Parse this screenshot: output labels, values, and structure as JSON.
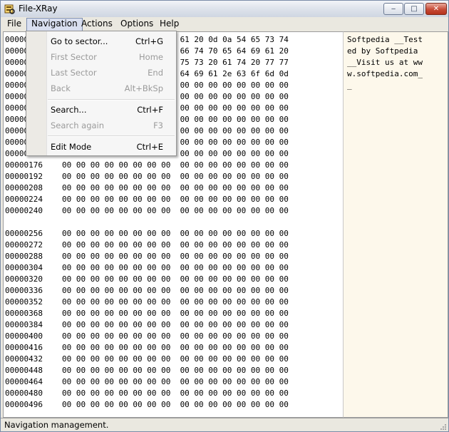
{
  "window": {
    "title": "File-XRay",
    "buttons": {
      "minimize": "‒",
      "maximize": "□",
      "close": "✕"
    }
  },
  "menubar": {
    "items": [
      "File",
      "Navigation",
      "Actions",
      "Options",
      "Help"
    ],
    "active": "Navigation"
  },
  "hex_rows": [
    {
      "addr": "00000000",
      "bytes": "53 6f 66 74 70 65 64 69  61 20 0d 0a 54 65 73 74"
    },
    {
      "addr": "00000016",
      "bytes": "65 64 20 62 79 20 53 6f  66 74 70 65 64 69 61 20"
    },
    {
      "addr": "00000032",
      "bytes": "0d 0a 56 69 73 69 74 20  75 73 20 61 74 20 77 77"
    },
    {
      "addr": "00000048",
      "bytes": "77 2e 73 6f 66 74 70 65  64 69 61 2e 63 6f 6d 0d"
    },
    {
      "addr": "00000064",
      "bytes": "0a 00 00 00 00 00 00 00  00 00 00 00 00 00 00 00"
    },
    {
      "addr": "00000080",
      "bytes": "00 00 00 00 00 00 00 00  00 00 00 00 00 00 00 00"
    },
    {
      "addr": "00000096",
      "bytes": "00 00 00 00 00 00 00 00  00 00 00 00 00 00 00 00"
    },
    {
      "addr": "00000112",
      "bytes": "00 00 00 00 00 00 00 00  00 00 00 00 00 00 00 00"
    },
    {
      "addr": "00000128",
      "bytes": "00 00 00 00 00 00 00 00  00 00 00 00 00 00 00 00"
    },
    {
      "addr": "00000144",
      "bytes": "00 00 00 00 00 00 00 00  00 00 00 00 00 00 00 00"
    },
    {
      "addr": "00000160",
      "bytes": "00 00 00 00 00 00 00 00  00 00 00 00 00 00 00 00"
    },
    {
      "addr": "00000176",
      "bytes": "00 00 00 00 00 00 00 00  00 00 00 00 00 00 00 00"
    },
    {
      "addr": "00000192",
      "bytes": "00 00 00 00 00 00 00 00  00 00 00 00 00 00 00 00"
    },
    {
      "addr": "00000208",
      "bytes": "00 00 00 00 00 00 00 00  00 00 00 00 00 00 00 00"
    },
    {
      "addr": "00000224",
      "bytes": "00 00 00 00 00 00 00 00  00 00 00 00 00 00 00 00"
    },
    {
      "addr": "00000240",
      "bytes": "00 00 00 00 00 00 00 00  00 00 00 00 00 00 00 00"
    },
    {
      "addr": "00000256",
      "bytes": "00 00 00 00 00 00 00 00  00 00 00 00 00 00 00 00"
    },
    {
      "addr": "00000272",
      "bytes": "00 00 00 00 00 00 00 00  00 00 00 00 00 00 00 00"
    },
    {
      "addr": "00000288",
      "bytes": "00 00 00 00 00 00 00 00  00 00 00 00 00 00 00 00"
    },
    {
      "addr": "00000304",
      "bytes": "00 00 00 00 00 00 00 00  00 00 00 00 00 00 00 00"
    },
    {
      "addr": "00000320",
      "bytes": "00 00 00 00 00 00 00 00  00 00 00 00 00 00 00 00"
    },
    {
      "addr": "00000336",
      "bytes": "00 00 00 00 00 00 00 00  00 00 00 00 00 00 00 00"
    },
    {
      "addr": "00000352",
      "bytes": "00 00 00 00 00 00 00 00  00 00 00 00 00 00 00 00"
    },
    {
      "addr": "00000368",
      "bytes": "00 00 00 00 00 00 00 00  00 00 00 00 00 00 00 00"
    },
    {
      "addr": "00000384",
      "bytes": "00 00 00 00 00 00 00 00  00 00 00 00 00 00 00 00"
    },
    {
      "addr": "00000400",
      "bytes": "00 00 00 00 00 00 00 00  00 00 00 00 00 00 00 00"
    },
    {
      "addr": "00000416",
      "bytes": "00 00 00 00 00 00 00 00  00 00 00 00 00 00 00 00"
    },
    {
      "addr": "00000432",
      "bytes": "00 00 00 00 00 00 00 00  00 00 00 00 00 00 00 00"
    },
    {
      "addr": "00000448",
      "bytes": "00 00 00 00 00 00 00 00  00 00 00 00 00 00 00 00"
    },
    {
      "addr": "00000464",
      "bytes": "00 00 00 00 00 00 00 00  00 00 00 00 00 00 00 00"
    },
    {
      "addr": "00000480",
      "bytes": "00 00 00 00 00 00 00 00  00 00 00 00 00 00 00 00"
    },
    {
      "addr": "00000496",
      "bytes": "00 00 00 00 00 00 00 00  00 00 00 00 00 00 00 00"
    }
  ],
  "ascii_lines": [
    "Softpedia __Test",
    "ed by Softpedia ",
    "__Visit us at ww",
    "w.softpedia.com_",
    "_"
  ],
  "navigation_menu": [
    {
      "label": "Go to sector...",
      "shortcut": "Ctrl+G",
      "enabled": true
    },
    {
      "label": "First Sector",
      "shortcut": "Home",
      "enabled": false
    },
    {
      "label": "Last Sector",
      "shortcut": "End",
      "enabled": false
    },
    {
      "label": "Back",
      "shortcut": "Alt+BkSp",
      "enabled": false
    },
    {
      "label": "Search...",
      "shortcut": "Ctrl+F",
      "enabled": true
    },
    {
      "label": "Search again",
      "shortcut": "F3",
      "enabled": false
    },
    {
      "label": "Edit Mode",
      "shortcut": "Ctrl+E",
      "enabled": true
    }
  ],
  "status": {
    "text": "Navigation management."
  },
  "colors": {
    "ascii_pane_bg": "#fdf8eb",
    "menu_highlight": "#d9dff0",
    "disabled_text": "#9b9b9b"
  }
}
